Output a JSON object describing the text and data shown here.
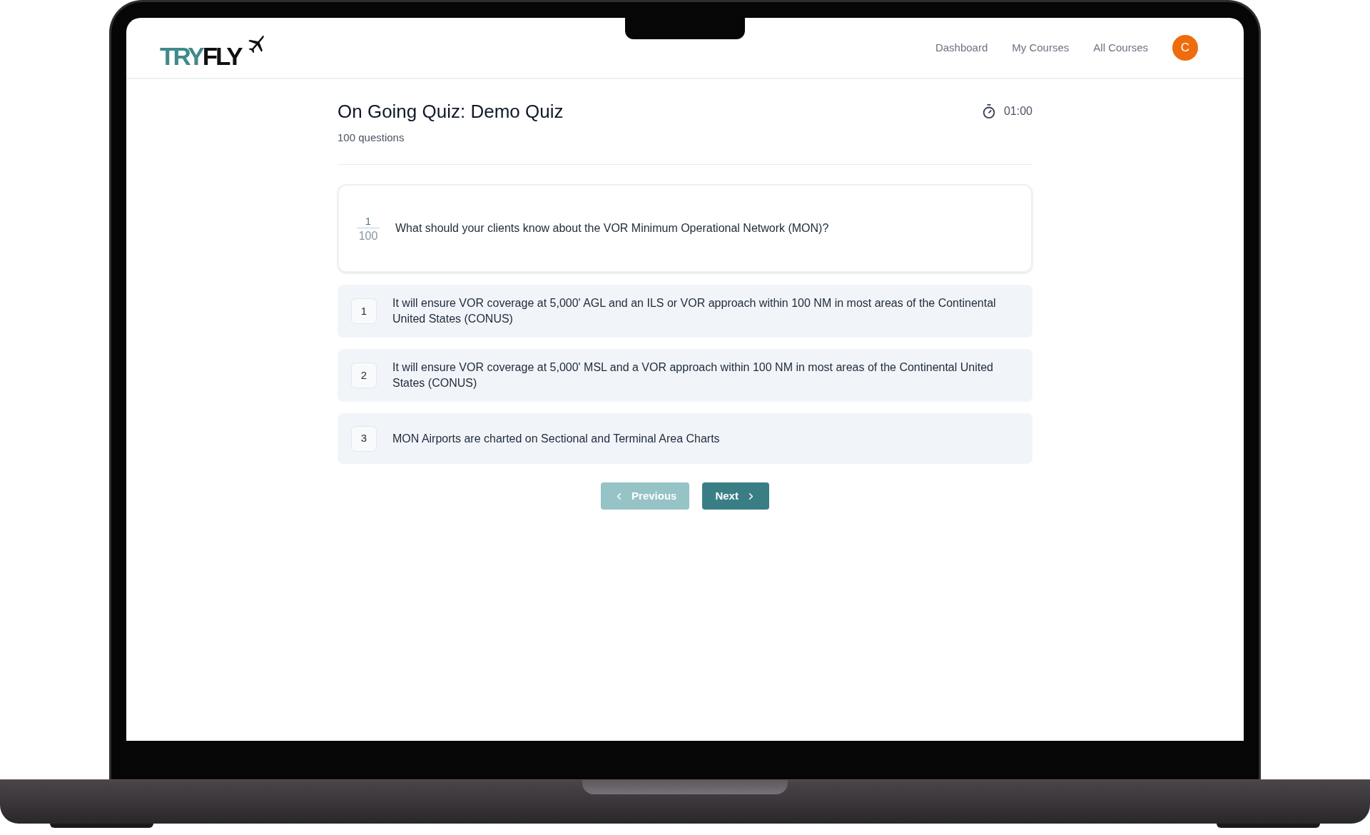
{
  "header": {
    "logo": {
      "part_1": "TRY",
      "part_2": "FLY"
    },
    "nav": [
      {
        "label": "Dashboard"
      },
      {
        "label": "My Courses"
      },
      {
        "label": "All Courses"
      }
    ],
    "avatar": "C"
  },
  "quiz": {
    "title": "On Going Quiz: Demo Quiz",
    "subtitle": "100 questions",
    "timer": "01:00"
  },
  "question": {
    "number": "1",
    "total": "100",
    "text": "What should your clients know about the VOR Minimum Operational Network (MON)?"
  },
  "options": [
    {
      "number": "1",
      "text": "It will ensure VOR coverage at 5,000' AGL and an ILS or VOR approach within 100 NM in most areas of the Continental United States (CONUS)",
      "selected": false
    },
    {
      "number": "2",
      "text": "It will ensure VOR coverage at 5,000' MSL and a VOR approach within 100 NM in most areas of the Continental United States (CONUS)",
      "selected": false
    },
    {
      "number": "3",
      "text": "MON Airports are charted on Sectional and Terminal Area Charts",
      "selected": false
    }
  ],
  "buttons": [
    {
      "kind": "previous",
      "label": "Previous",
      "disabled": true
    },
    {
      "kind": "next",
      "label": "Next",
      "disabled": false
    }
  ]
}
